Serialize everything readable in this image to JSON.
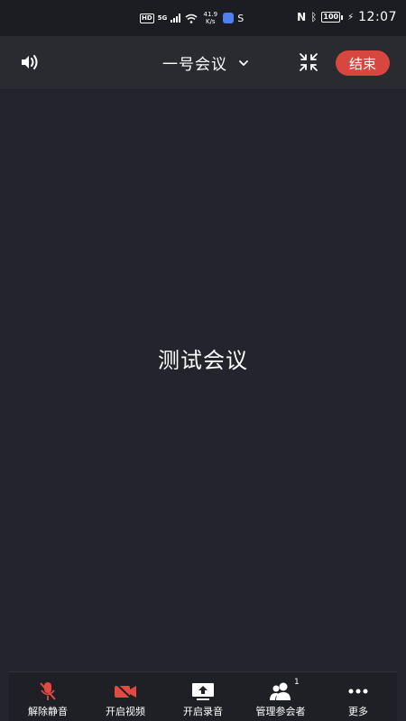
{
  "status_bar": {
    "hd": "HD",
    "network_type": "5G",
    "net_speed": "41.9",
    "net_speed_unit": "K/s",
    "s_glyph": "S",
    "nfc": "N",
    "bluetooth": "ᛒ",
    "battery": "100",
    "charging": "⚡",
    "time": "12:07"
  },
  "header": {
    "title": "一号会议",
    "end_label": "结束"
  },
  "main": {
    "topic": "测试会议"
  },
  "toolbar": {
    "items": [
      {
        "label": "解除静音",
        "icon": "mic-muted-icon"
      },
      {
        "label": "开启视频",
        "icon": "video-off-icon"
      },
      {
        "label": "开启录音",
        "icon": "screen-share-icon"
      },
      {
        "label": "管理参会者",
        "icon": "participants-icon",
        "badge": "1"
      },
      {
        "label": "更多",
        "icon": "more-icon"
      }
    ]
  },
  "colors": {
    "end_button": "#d7463f",
    "muted_red": "#e04a43",
    "background": "#24252c"
  }
}
